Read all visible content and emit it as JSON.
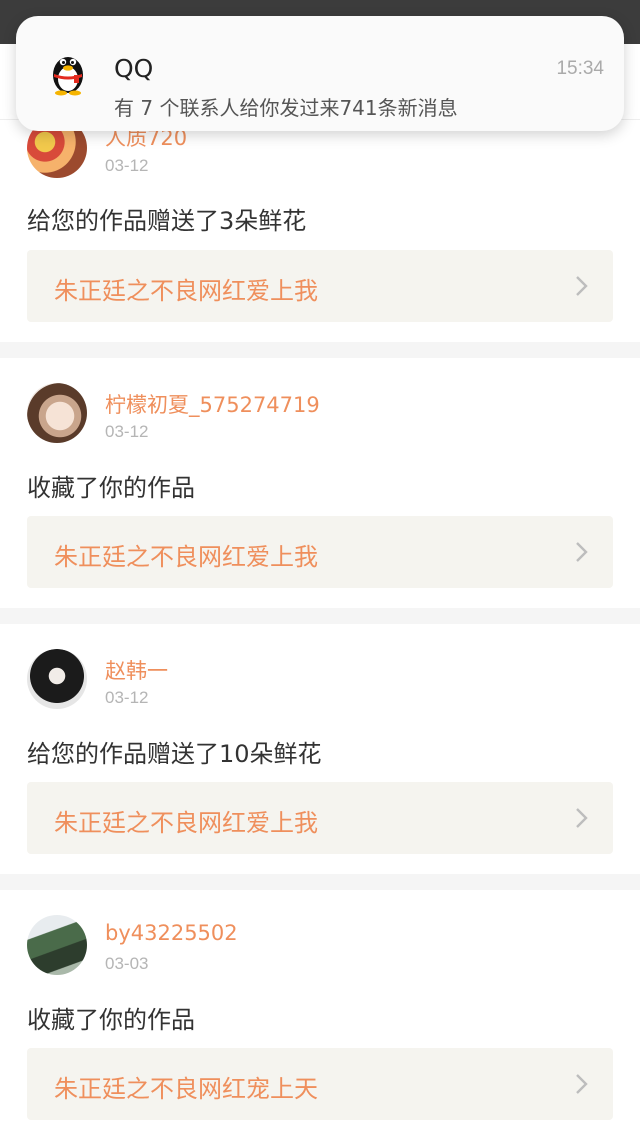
{
  "colors": {
    "accent": "#ef8f5c",
    "work_bg": "#f5f4ef",
    "divider": "#f5f5f5"
  },
  "notification": {
    "app_name": "QQ",
    "time": "15:34",
    "message": "有 7 个联系人给你发过来741条新消息",
    "icon": "qq-penguin-icon"
  },
  "feed": [
    {
      "username": "人质720",
      "date": "03-12",
      "action": "给您的作品赠送了3朵鲜花",
      "work_title": "朱正廷之不良网红爱上我"
    },
    {
      "username": "柠檬初夏_575274719",
      "date": "03-12",
      "action": "收藏了你的作品",
      "work_title": "朱正廷之不良网红爱上我"
    },
    {
      "username": "赵韩一",
      "date": "03-12",
      "action": "给您的作品赠送了10朵鲜花",
      "work_title": "朱正廷之不良网红爱上我"
    },
    {
      "username": "by43225502",
      "date": "03-03",
      "action": "收藏了你的作品",
      "work_title": "朱正廷之不良网红宠上天"
    }
  ]
}
